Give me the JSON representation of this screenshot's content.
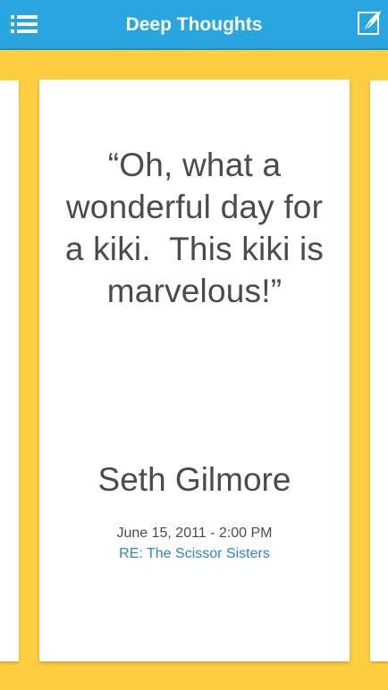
{
  "header": {
    "title": "Deep Thoughts",
    "menu_icon": "hamburger-menu-icon",
    "compose_icon": "quill-compose-icon"
  },
  "card": {
    "quote_line_1": "“Oh, what a",
    "quote_line_2": "wonderful day for",
    "quote_line_3": "a kiki.  This kiki is",
    "quote_line_4": "marvelous!”",
    "author": "Seth Gilmore",
    "date": "June 15, 2011 - 2:00 PM",
    "re_link": "RE: The Scissor Sisters"
  },
  "colors": {
    "header_bg": "#29a6e0",
    "page_bg": "#ffcf41",
    "card_bg": "#ffffff",
    "text": "#4b4b4b",
    "link": "#2e86c1"
  }
}
